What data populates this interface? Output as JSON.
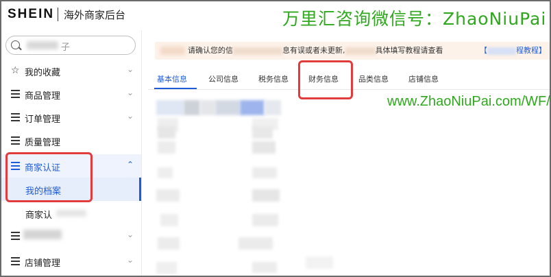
{
  "header": {
    "logo": "SHEIN",
    "portal_title": "海外商家后台",
    "watermark_title": "万里汇咨询微信号：ZhaoNiuPai",
    "watermark_url": "www.ZhaoNiuPai.com/WF/"
  },
  "sidebar": {
    "search_placeholder": "子",
    "items": [
      {
        "label": "我的收藏",
        "icon": "star-icon"
      },
      {
        "label": "商品管理",
        "icon": "menu-icon"
      },
      {
        "label": "订单管理",
        "icon": "menu-icon"
      },
      {
        "label": "质量管理",
        "icon": "menu-icon"
      },
      {
        "label": "商家认证",
        "icon": "menu-icon",
        "expanded": true
      },
      {
        "label": "我的档案",
        "sub": true,
        "selected": true
      },
      {
        "label": "商家认",
        "sub": true
      },
      {
        "label": "",
        "icon": "menu-icon"
      },
      {
        "label": "店铺管理",
        "icon": "menu-icon"
      }
    ]
  },
  "notice": {
    "text_start": "请确认您的信",
    "text_mid": "息有误或者未更新,",
    "text_end": "具体填写教程请查看",
    "link_start": "【",
    "link_end": "程教程】"
  },
  "tabs": [
    "基本信息",
    "公司信息",
    "税务信息",
    "财务信息",
    "品类信息",
    "店铺信息"
  ],
  "active_tab": "基本信息",
  "colors": {
    "accent": "#1e5bd9",
    "highlight_box": "#e23b3b",
    "watermark": "#2fa81e",
    "notice_bg": "#fdf2e9"
  }
}
